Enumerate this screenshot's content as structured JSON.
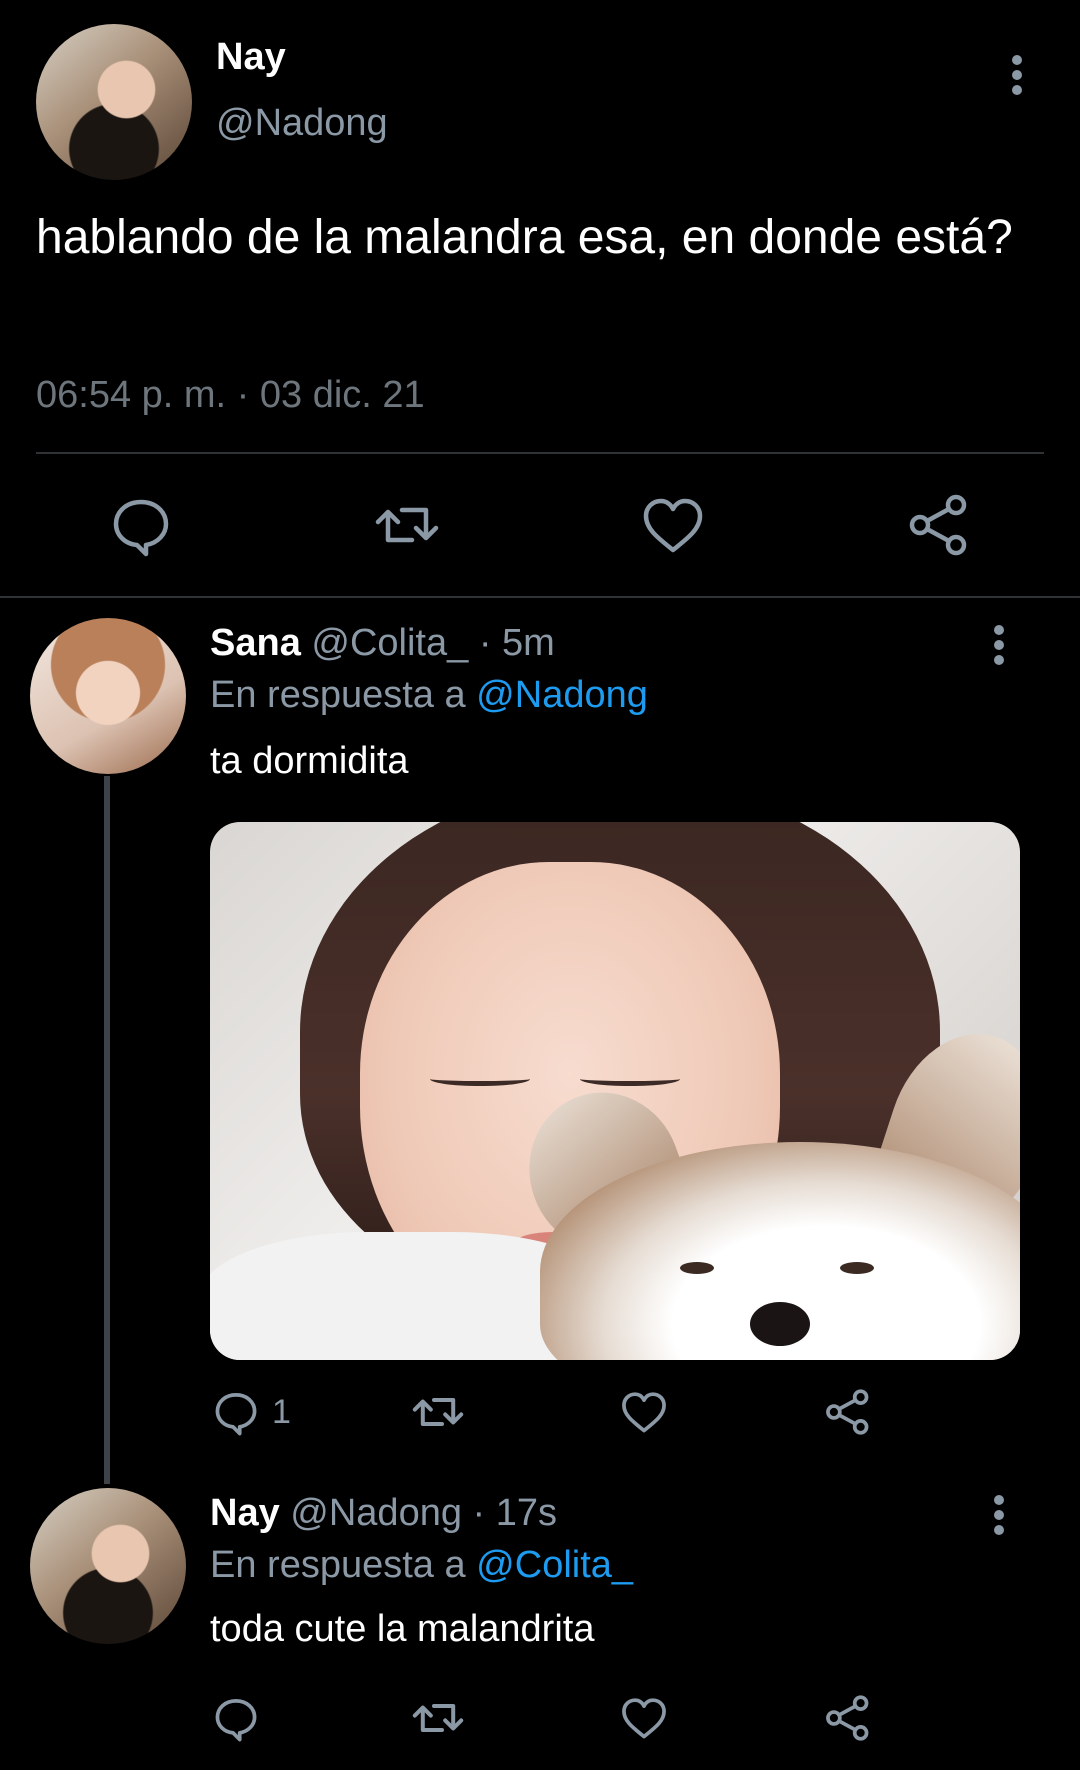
{
  "main_tweet": {
    "name": "Nay",
    "handle": "@Nadong",
    "text": "hablando de la malandra esa, en donde está?",
    "timestamp": "06:54 p. m. · 03 dic. 21"
  },
  "replies": [
    {
      "name": "Sana",
      "handle": "@Colita_",
      "separator": "·",
      "time": "5m",
      "reply_prefix": "En respuesta a",
      "reply_to": "@Nadong",
      "text": "ta dormidita",
      "reply_count": "1"
    },
    {
      "name": "Nay",
      "handle": "@Nadong",
      "separator": "·",
      "time": "17s",
      "reply_prefix": "En respuesta a",
      "reply_to": "@Colita_",
      "text": "toda cute la malandrita",
      "reply_count": ""
    }
  ],
  "colors": {
    "background": "#000000",
    "text_primary": "#ffffff",
    "text_secondary": "#8b98a5",
    "accent": "#1d9bf0",
    "divider": "#2f3336"
  },
  "icons": [
    "more-vertical-icon",
    "reply-icon",
    "retweet-icon",
    "like-icon",
    "share-icon"
  ]
}
